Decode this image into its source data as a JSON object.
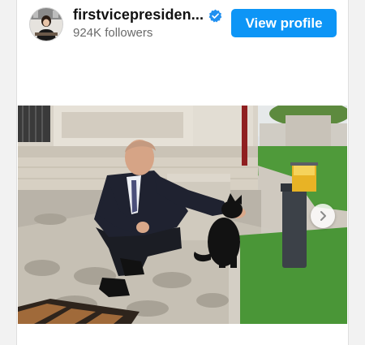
{
  "post": {
    "username": "firstvicepresiden...",
    "followers": "924K followers",
    "view_profile_label": "View profile"
  },
  "icons": {
    "verified": "verified-badge-icon",
    "next": "chevron-right-icon"
  },
  "colors": {
    "button_bg": "#0d95f6",
    "verified_badge": "#1f8ff0"
  }
}
